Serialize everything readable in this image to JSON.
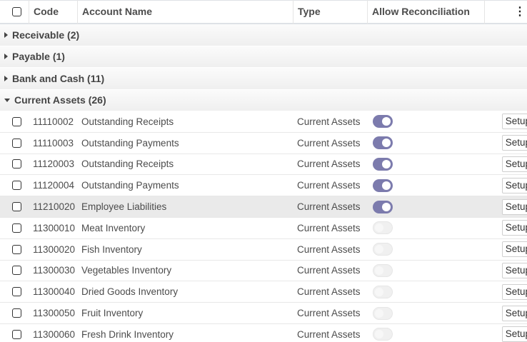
{
  "columns": {
    "code": "Code",
    "name": "Account Name",
    "type": "Type",
    "reconciliation": "Allow Reconciliation"
  },
  "options_icon": "vertical-dots-icon",
  "groups": [
    {
      "label": "Receivable (2)",
      "expanded": false
    },
    {
      "label": "Payable (1)",
      "expanded": false
    },
    {
      "label": "Bank and Cash (11)",
      "expanded": false
    },
    {
      "label": "Current Assets (26)",
      "expanded": true
    }
  ],
  "rows": [
    {
      "code": "11110002",
      "name": "Outstanding Receipts",
      "type": "Current Assets",
      "reconcile": true,
      "action": "Setup"
    },
    {
      "code": "11110003",
      "name": "Outstanding Payments",
      "type": "Current Assets",
      "reconcile": true,
      "action": "Setup"
    },
    {
      "code": "11120003",
      "name": "Outstanding Receipts",
      "type": "Current Assets",
      "reconcile": true,
      "action": "Setup"
    },
    {
      "code": "11120004",
      "name": "Outstanding Payments",
      "type": "Current Assets",
      "reconcile": true,
      "action": "Setup"
    },
    {
      "code": "11210020",
      "name": "Employee Liabilities",
      "type": "Current Assets",
      "reconcile": true,
      "action": "Setup"
    },
    {
      "code": "11300010",
      "name": "Meat Inventory",
      "type": "Current Assets",
      "reconcile": false,
      "action": "Setup"
    },
    {
      "code": "11300020",
      "name": "Fish Inventory",
      "type": "Current Assets",
      "reconcile": false,
      "action": "Setup"
    },
    {
      "code": "11300030",
      "name": "Vegetables Inventory",
      "type": "Current Assets",
      "reconcile": false,
      "action": "Setup"
    },
    {
      "code": "11300040",
      "name": "Dried Goods Inventory",
      "type": "Current Assets",
      "reconcile": false,
      "action": "Setup"
    },
    {
      "code": "11300050",
      "name": "Fruit Inventory",
      "type": "Current Assets",
      "reconcile": false,
      "action": "Setup"
    },
    {
      "code": "11300060",
      "name": "Fresh Drink Inventory",
      "type": "Current Assets",
      "reconcile": false,
      "action": "Setup"
    }
  ],
  "colors": {
    "toggle_on": "#7c7bad",
    "toggle_off": "#f0f0f0",
    "row_highlight": "#eaeaea"
  }
}
